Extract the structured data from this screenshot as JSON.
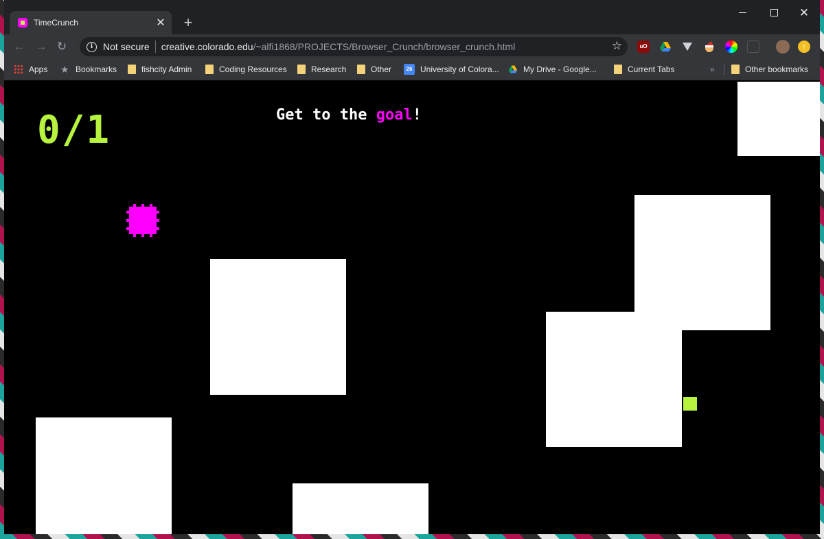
{
  "browser": {
    "tab": {
      "title": "TimeCrunch",
      "close_glyph": "✕"
    },
    "new_tab_glyph": "+",
    "window_controls": {
      "close_glyph": "✕"
    },
    "address_bar": {
      "security_label": "Not secure",
      "url_host": "creative.colorado.edu",
      "url_path": "/~alfi1868/PROJECTS/Browser_Crunch/browser_crunch.html"
    },
    "extensions": [
      {
        "name": "ublock-icon",
        "text": "uO"
      }
    ],
    "bookmarks": [
      {
        "label": "Apps",
        "icon": "apps-icon"
      },
      {
        "label": "Bookmarks",
        "icon": "star-icon"
      },
      {
        "label": "fishcity Admin",
        "icon": "folder-icon"
      },
      {
        "label": "Coding Resources",
        "icon": "folder-icon"
      },
      {
        "label": "Research",
        "icon": "folder-icon"
      },
      {
        "label": "Other",
        "icon": "folder-icon"
      },
      {
        "label": "University of Colora...",
        "icon": "calendar-icon",
        "icon_text": "26"
      },
      {
        "label": "My Drive - Google...",
        "icon": "google-drive-icon"
      },
      {
        "label": "Current Tabs",
        "icon": "folder-icon"
      }
    ],
    "overflow_glyph": "»",
    "other_bookmarks": "Other bookmarks"
  },
  "game": {
    "counter": "0/1",
    "instruction_prefix": "Get to the ",
    "instruction_highlight": "goal",
    "instruction_suffix": "!",
    "colors": {
      "player": "#ff00ff",
      "goal": "#b6f23e",
      "obstacle": "#ffffff",
      "background": "#000000"
    }
  }
}
